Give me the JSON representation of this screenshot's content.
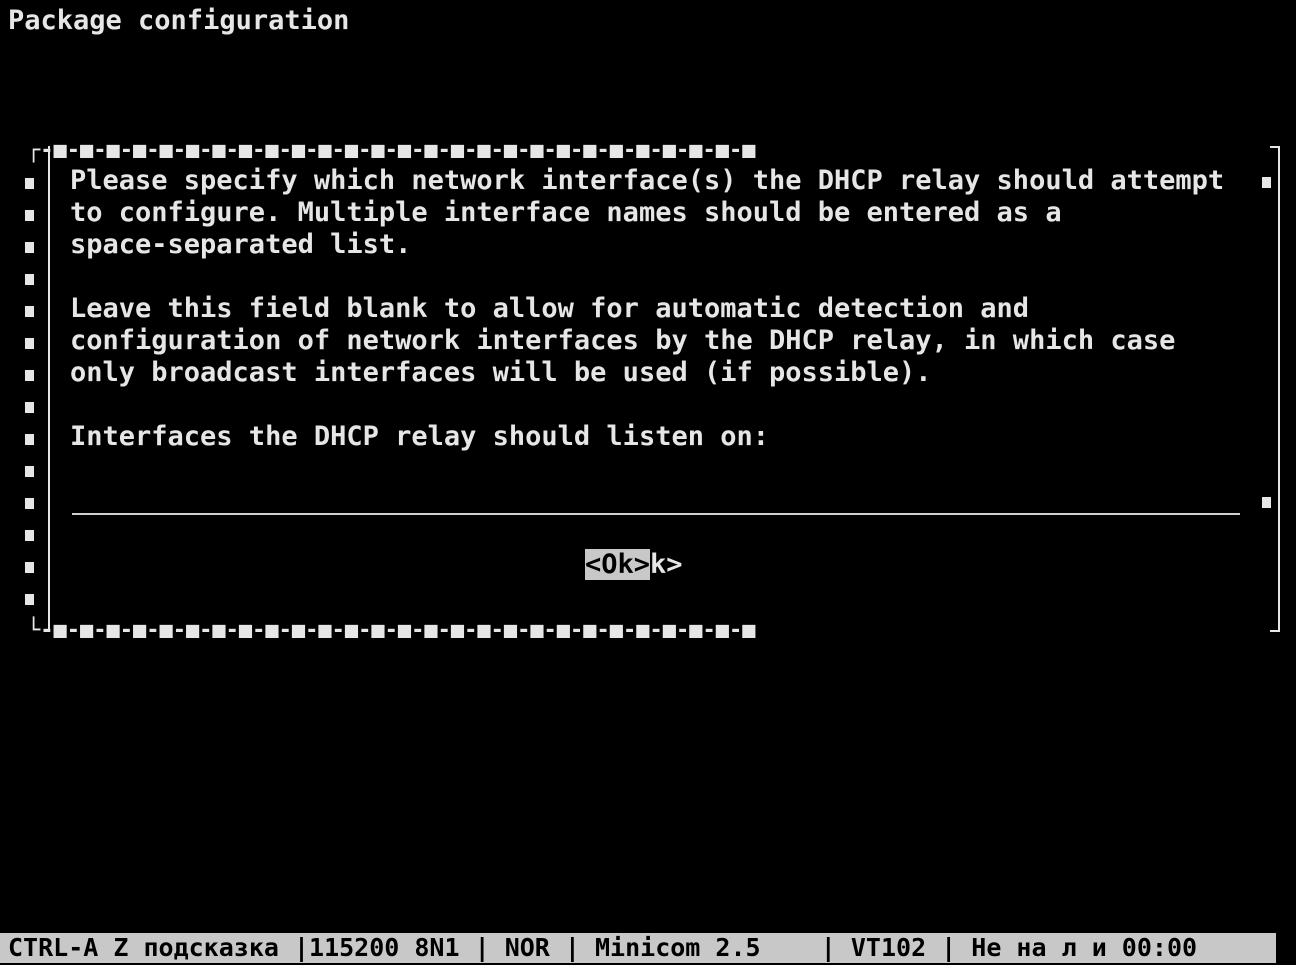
{
  "screen_title": "Package configuration",
  "dialog": {
    "paragraph1": [
      "Please specify which network interface(s) the DHCP relay should attempt",
      "to configure. Multiple interface names should be entered as a",
      "space-separated list."
    ],
    "paragraph2": [
      "Leave this field blank to allow for automatic detection and",
      "configuration of network interfaces by the DHCP relay, in which case",
      "only broadcast interfaces will be used (if possible)."
    ],
    "prompt": "Interfaces the DHCP relay should listen on:",
    "input_value": "",
    "ok_button_label": "<Ok>",
    "ok_trailing": "k>"
  },
  "status_bar": "CTRL-A Z подсказка |115200 8N1 | NOR | Minicom 2.5    | VT102 | Не на л и 00:00"
}
